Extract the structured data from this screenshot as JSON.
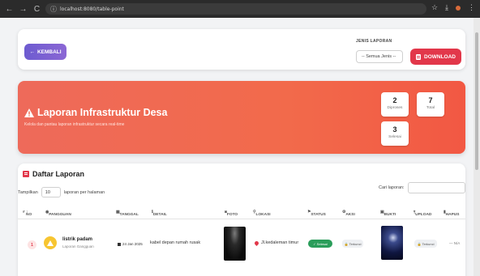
{
  "browser": {
    "url": "localhost:8080/table-point",
    "nav_back": "←",
    "nav_forward": "→",
    "nav_reload": "C",
    "info_icon": "ⓘ"
  },
  "topbar": {
    "back_label": "KEMBALI",
    "jenis_label": "JENIS LAPORAN",
    "jenis_value": "-- Semua Jenis --",
    "download_label": "DOWNLOAD"
  },
  "banner": {
    "title": "Laporan Infrastruktur Desa",
    "subtitle": "Kelola dan pantau laporan infrastruktur secara real-time",
    "stats": [
      {
        "value": "2",
        "label": "Diproses"
      },
      {
        "value": "7",
        "label": "Total"
      },
      {
        "value": "3",
        "label": "Selesai"
      }
    ]
  },
  "table": {
    "title": "Daftar Laporan",
    "show_label": "Tampilkan",
    "per_page": "10",
    "per_page_suffix": "laporan per halaman",
    "search_label": "Cari laporan:",
    "columns": [
      "NO",
      "PANGGUAN",
      "TANGGAL",
      "DETAIL",
      "FOTO",
      "LOKASI",
      "STATUS",
      "AKSI",
      "BUKTI",
      "UPLOAD",
      "HAPUS"
    ],
    "rows": [
      {
        "no": "1",
        "name": "listrik padam",
        "category": "Laporan Gangguan",
        "date": "24 Jan 2025",
        "detail": "kabel depan rumah rusak",
        "location": "Jl.kedaleman timur",
        "status": "Selesai",
        "aksi": "Terkunci",
        "upload": "Terkunci",
        "hapus": "— N/A"
      }
    ]
  },
  "colors": {
    "accent_purple": "#6d5bd0",
    "accent_red": "#e2374a",
    "banner": "#f26a4b",
    "status_green": "#2a9d5a"
  }
}
